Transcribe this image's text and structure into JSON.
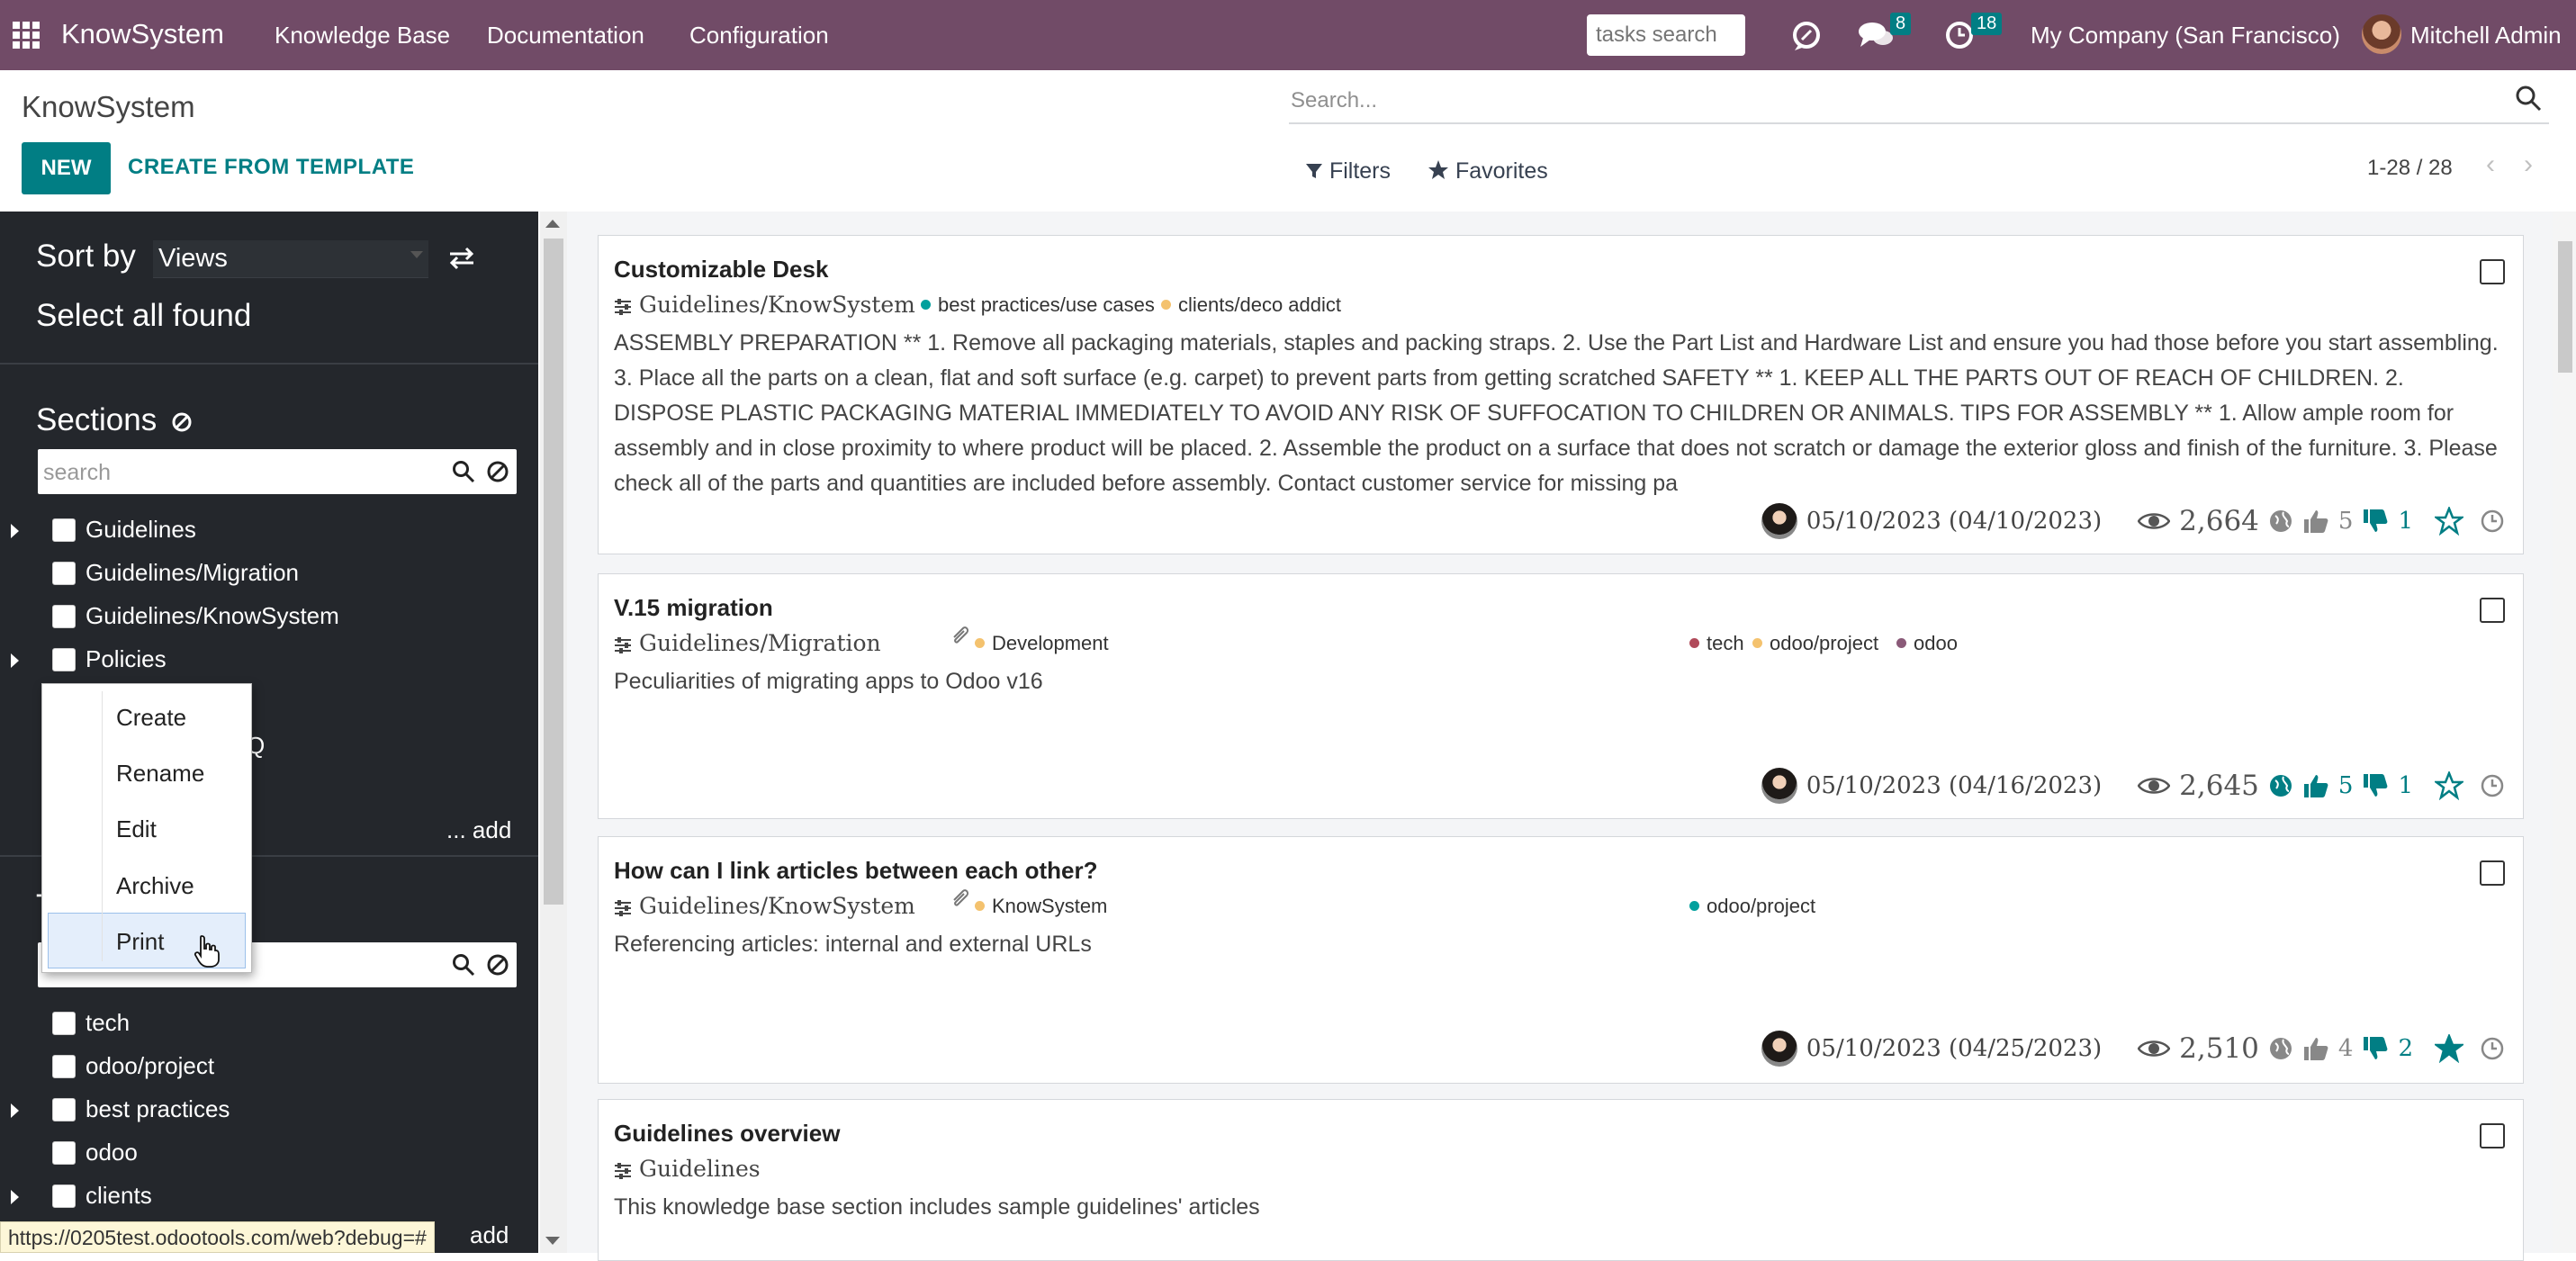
{
  "nav": {
    "brand": "KnowSystem",
    "menus": [
      "Knowledge Base",
      "Documentation",
      "Configuration"
    ],
    "tasks_search_placeholder": "tasks search",
    "messages_count": "8",
    "activities_count": "18",
    "company": "My Company (San Francisco)",
    "user": "Mitchell Admin"
  },
  "control_panel": {
    "title": "KnowSystem",
    "new_label": "NEW",
    "template_label": "CREATE FROM TEMPLATE",
    "search_placeholder": "Search...",
    "filters_label": "Filters",
    "favorites_label": "Favorites",
    "pager": "1-28 / 28"
  },
  "sidebar": {
    "sort_label": "Sort by",
    "sort_value": "Views",
    "select_all": "Select all found",
    "sections_title": "Sections",
    "sections_search_placeholder": "search",
    "sections": [
      {
        "label": "Guidelines",
        "expandable": true
      },
      {
        "label": "Guidelines/Migration",
        "expandable": false
      },
      {
        "label": "Guidelines/KnowSystem",
        "expandable": false
      },
      {
        "label": "Policies",
        "expandable": true
      }
    ],
    "hidden_fragment": "Q",
    "add_label": "... add",
    "tags_title_fragment": "T",
    "tags_search_placeholder": "search",
    "tags": [
      {
        "label": "tech",
        "expandable": false
      },
      {
        "label": "odoo/project",
        "expandable": false
      },
      {
        "label": "best practices",
        "expandable": true
      },
      {
        "label": "odoo",
        "expandable": false
      },
      {
        "label": "clients",
        "expandable": true
      }
    ],
    "tags_add_label": "add"
  },
  "context_menu": {
    "items": [
      "Create",
      "Rename",
      "Edit",
      "Archive",
      "Print"
    ]
  },
  "status_url": "https://0205test.odootools.com/web?debug=#",
  "colors": {
    "navbar": "#714b67",
    "accent": "#017e84",
    "sidebar": "#24272c",
    "tag_green": "#00a09d",
    "tag_orange": "#f4c26e",
    "tag_red": "#b04a5a",
    "tag_purple": "#8a5a78"
  },
  "articles": [
    {
      "title": "Customizable Desk",
      "section": "Guidelines/KnowSystem",
      "tags_left": [
        {
          "label": "best practices/use cases",
          "color": "#00a09d"
        },
        {
          "label": "clients/deco addict",
          "color": "#f4c26e"
        }
      ],
      "description": "ASSEMBLY PREPARATION ** 1. Remove all packaging materials, staples and packing straps. 2. Use the Part List and Hardware List and ensure you had those before you start assembling. 3. Place all the parts on a clean, flat and soft surface (e.g. carpet) to prevent parts from getting scratched SAFETY ** 1. KEEP ALL THE PARTS OUT OF REACH OF CHILDREN. 2. DISPOSE PLASTIC PACKAGING MATERIAL IMMEDIATELY TO AVOID ANY RISK OF SUFFOCATION TO CHILDREN OR ANIMALS. TIPS FOR ASSEMBLY ** 1. Allow ample room for assembly and in close proximity to where product will be placed. 2. Assemble the product on a surface that does not scratch or damage the exterior gloss and finish of the furniture. 3. Please check all of the parts and quantities are included before assembly. Contact customer service for missing pa",
      "dates": "05/10/2023 (04/10/2023)",
      "views": "2,664",
      "likes": "5",
      "dislikes": "1",
      "favorite": false,
      "published": false
    },
    {
      "title": "V.15 migration",
      "section": "Guidelines/Migration",
      "attachment": true,
      "tags_left": [
        {
          "label": "Development",
          "color": "#f4c26e"
        }
      ],
      "tags_right": [
        {
          "label": "tech",
          "color": "#b04a5a"
        },
        {
          "label": "odoo/project",
          "color": "#f4c26e"
        },
        {
          "label": "odoo",
          "color": "#8a5a78"
        }
      ],
      "description": "Peculiarities of migrating apps to Odoo v16",
      "dates": "05/10/2023 (04/16/2023)",
      "views": "2,645",
      "likes": "5",
      "dislikes": "1",
      "favorite": false,
      "published": true
    },
    {
      "title": "How can I link articles between each other?",
      "section": "Guidelines/KnowSystem",
      "attachment": true,
      "tags_left": [
        {
          "label": "KnowSystem",
          "color": "#f4c26e"
        }
      ],
      "tags_right": [
        {
          "label": "odoo/project",
          "color": "#00a09d"
        }
      ],
      "description": "Referencing articles: internal and external URLs",
      "dates": "05/10/2023 (04/25/2023)",
      "views": "2,510",
      "likes": "4",
      "dislikes": "2",
      "favorite": true,
      "published": false
    },
    {
      "title": "Guidelines overview",
      "section": "Guidelines",
      "description": "This knowledge base section includes sample guidelines' articles"
    }
  ]
}
